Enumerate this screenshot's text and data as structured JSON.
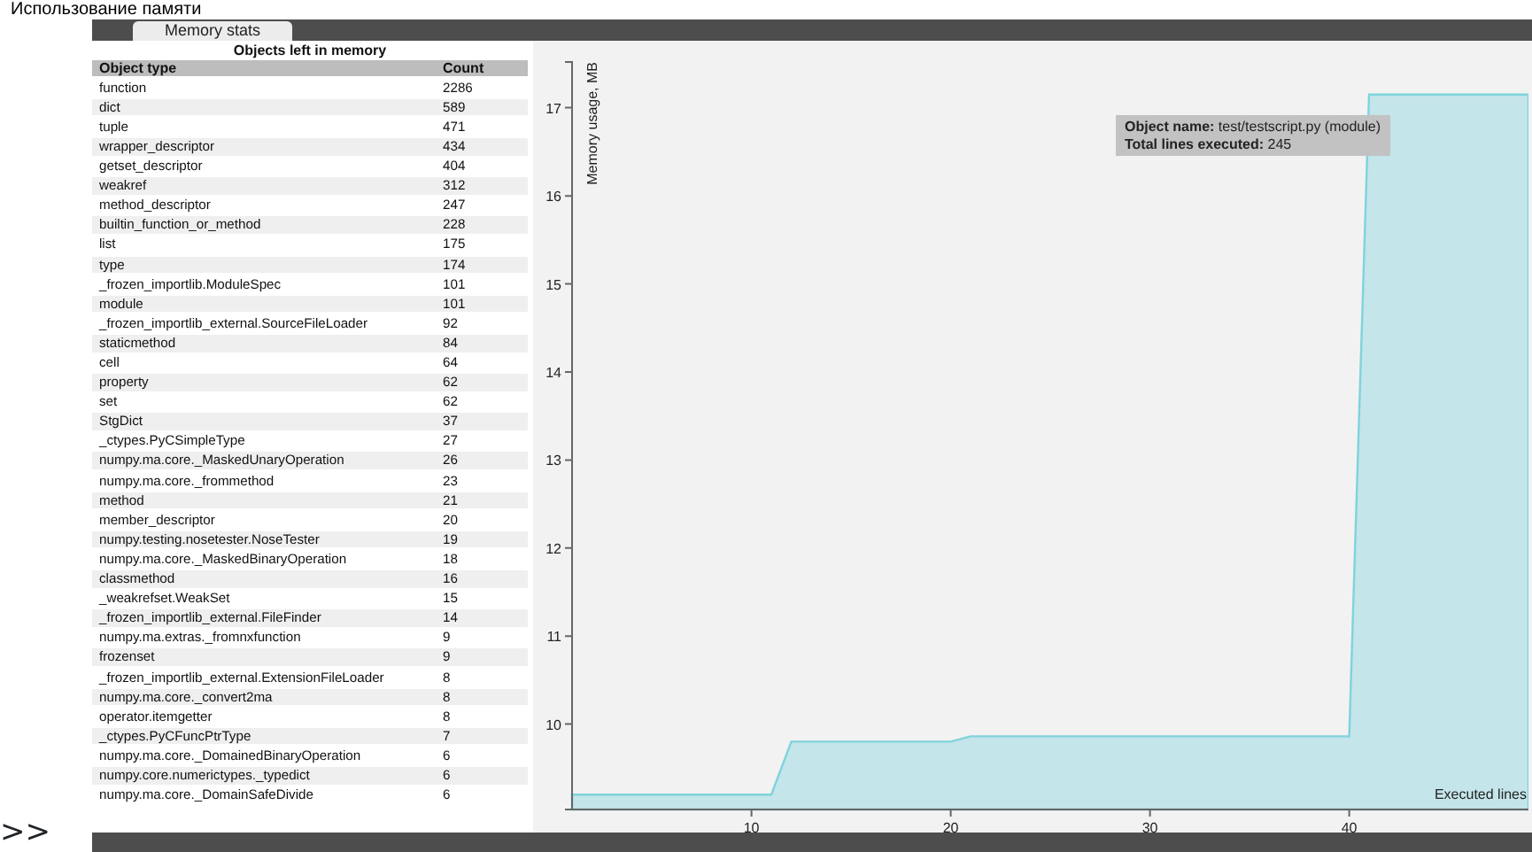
{
  "page_heading": "Использование памяти",
  "tabs": [
    {
      "label": "Memory stats",
      "selected": true
    }
  ],
  "objects_table": {
    "title": "Objects left in memory",
    "columns": [
      "Object type",
      "Count"
    ],
    "rows": [
      [
        "function",
        "2286"
      ],
      [
        "dict",
        "589"
      ],
      [
        "tuple",
        "471"
      ],
      [
        "wrapper_descriptor",
        "434"
      ],
      [
        "getset_descriptor",
        "404"
      ],
      [
        "weakref",
        "312"
      ],
      [
        "method_descriptor",
        "247"
      ],
      [
        "builtin_function_or_method",
        "228"
      ],
      [
        "list",
        "175"
      ],
      [
        "type",
        "174"
      ],
      [
        "_frozen_importlib.ModuleSpec",
        "101"
      ],
      [
        "module",
        "101"
      ],
      [
        "_frozen_importlib_external.SourceFileLoader",
        "92"
      ],
      [
        "staticmethod",
        "84"
      ],
      [
        "cell",
        "64"
      ],
      [
        "property",
        "62"
      ],
      [
        "set",
        "62"
      ],
      [
        "StgDict",
        "37"
      ],
      [
        "_ctypes.PyCSimpleType",
        "27"
      ],
      [
        "numpy.ma.core._MaskedUnaryOperation",
        "26"
      ],
      [
        "numpy.ma.core._frommethod",
        "23"
      ],
      [
        "method",
        "21"
      ],
      [
        "member_descriptor",
        "20"
      ],
      [
        "numpy.testing.nosetester.NoseTester",
        "19"
      ],
      [
        "numpy.ma.core._MaskedBinaryOperation",
        "18"
      ],
      [
        "classmethod",
        "16"
      ],
      [
        "_weakrefset.WeakSet",
        "15"
      ],
      [
        "_frozen_importlib_external.FileFinder",
        "14"
      ],
      [
        "numpy.ma.extras._fromnxfunction",
        "9"
      ],
      [
        "frozenset",
        "9"
      ],
      [
        "_frozen_importlib_external.ExtensionFileLoader",
        "8"
      ],
      [
        "numpy.ma.core._convert2ma",
        "8"
      ],
      [
        "operator.itemgetter",
        "8"
      ],
      [
        "_ctypes.PyCFuncPtrType",
        "7"
      ],
      [
        "numpy.ma.core._DomainedBinaryOperation",
        "6"
      ],
      [
        "numpy.core.numerictypes._typedict",
        "6"
      ],
      [
        "numpy.ma.core._DomainSafeDivide",
        "6"
      ]
    ]
  },
  "memory_chart": {
    "chart_data": {
      "type": "area",
      "xlabel": "Executed lines",
      "ylabel": "Memory usage, MB",
      "x": [
        1,
        11,
        12,
        20,
        21,
        40,
        41,
        49
      ],
      "series": [
        {
          "color": "#7fd3dc",
          "values": [
            9.2,
            9.2,
            9.8,
            9.8,
            9.86,
            9.86,
            17.15,
            17.15
          ]
        }
      ],
      "xlim": [
        1,
        49
      ],
      "ylim": [
        9.03,
        17.52
      ],
      "xticks": [
        10,
        20,
        30,
        40
      ],
      "yticks": [
        10,
        11,
        12,
        13,
        14,
        15,
        16,
        17
      ]
    },
    "tooltip": [
      "**Object name:** test/testscript.py (module)",
      "**Total lines executed:** 245"
    ]
  },
  "expand_toggle": ">>"
}
